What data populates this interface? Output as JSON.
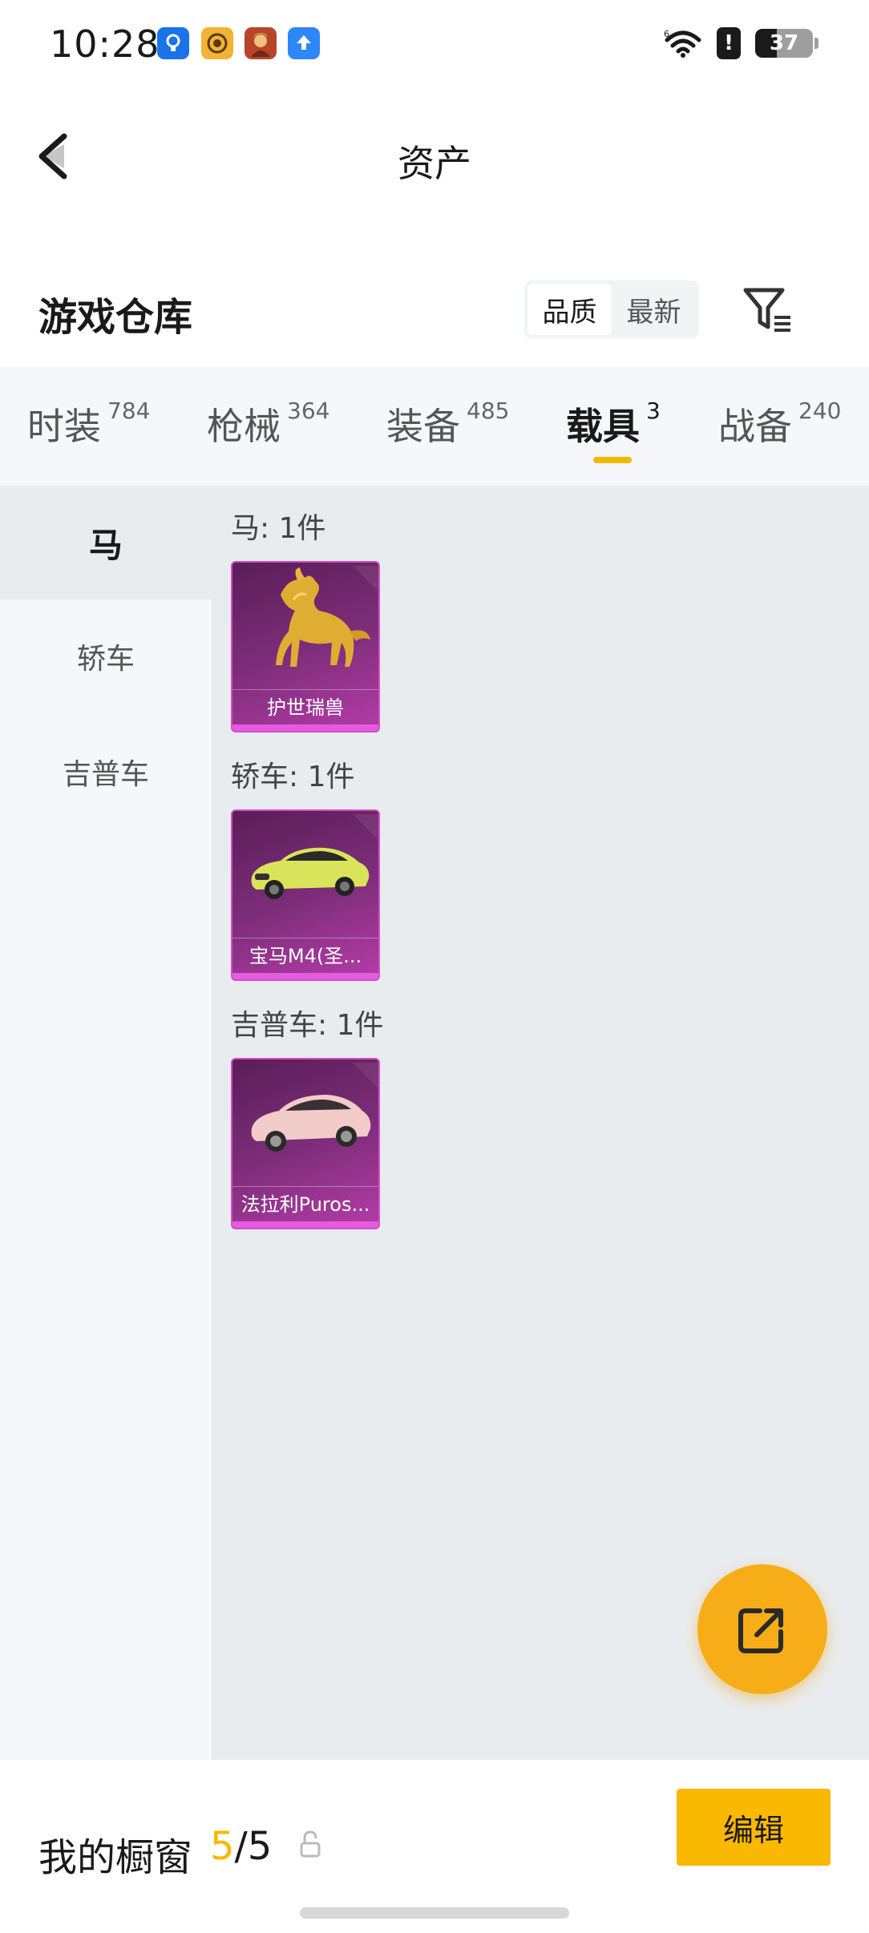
{
  "status_bar": {
    "time": "10:28",
    "apps": [
      {
        "icon": "lightbulb-app-icon",
        "color": "#1a73e8",
        "glyph": "◎"
      },
      {
        "icon": "target-app-icon",
        "color": "#f2b233",
        "glyph": "◉"
      },
      {
        "icon": "game-avatar-app-icon",
        "color": "#b8452a",
        "glyph": "☻"
      },
      {
        "icon": "upload-app-icon",
        "color": "#2f86f6",
        "glyph": "⬆"
      }
    ],
    "alert_glyph": "!",
    "battery_level": "37"
  },
  "header": {
    "title": "资产"
  },
  "warehouse": {
    "title": "游戏仓库",
    "sort_options": [
      "品质",
      "最新"
    ],
    "active_sort": 0
  },
  "tabs": [
    {
      "label": "时装",
      "count": "784"
    },
    {
      "label": "枪械",
      "count": "364"
    },
    {
      "label": "装备",
      "count": "485"
    },
    {
      "label": "载具",
      "count": "3"
    },
    {
      "label": "战备",
      "count": "240"
    }
  ],
  "active_tab": 3,
  "sidebar": {
    "items": [
      "马",
      "轿车",
      "吉普车"
    ],
    "active": 0
  },
  "groups": [
    {
      "label": "马: 1件",
      "items": [
        {
          "name": "护世瑞兽",
          "art": "golden-horse"
        }
      ]
    },
    {
      "label": "轿车: 1件",
      "items": [
        {
          "name": "宝马M4(圣...",
          "art": "yellow-car"
        }
      ]
    },
    {
      "label": "吉普车: 1件",
      "items": [
        {
          "name": "法拉利Puros...",
          "art": "pink-car"
        }
      ]
    }
  ],
  "bottom_bar": {
    "label": "我的橱窗",
    "current": "5",
    "separator": "/",
    "total": "5",
    "edit_label": "编辑"
  },
  "colors": {
    "accent": "#f5b800",
    "card_purple": "#7c2d78",
    "card_bar": "#e75be0"
  }
}
